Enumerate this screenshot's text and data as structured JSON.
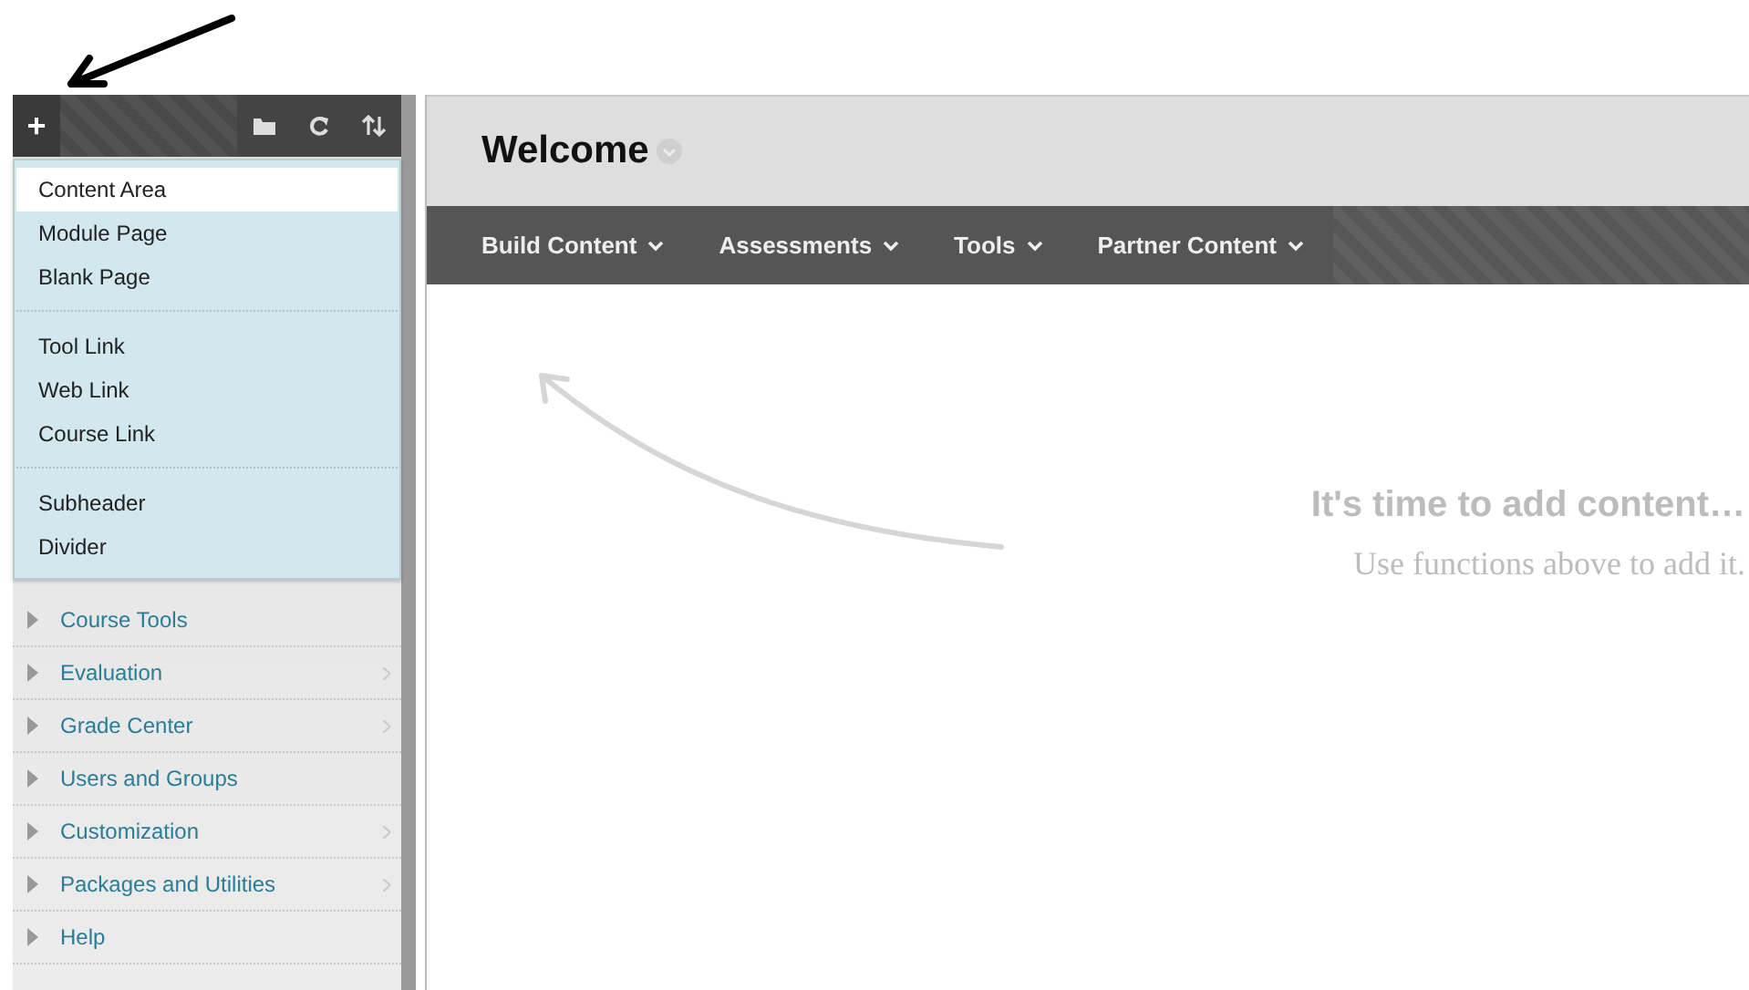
{
  "sidebar": {
    "toolbar": {
      "add_button": "+"
    },
    "add_menu": {
      "groups": [
        [
          {
            "label": "Content Area",
            "selected": true
          },
          {
            "label": "Module Page",
            "selected": false
          },
          {
            "label": "Blank Page",
            "selected": false
          }
        ],
        [
          {
            "label": "Tool Link",
            "selected": false
          },
          {
            "label": "Web Link",
            "selected": false
          },
          {
            "label": "Course Link",
            "selected": false
          }
        ],
        [
          {
            "label": "Subheader",
            "selected": false
          },
          {
            "label": "Divider",
            "selected": false
          }
        ]
      ]
    },
    "items": [
      {
        "label": "Course Tools",
        "has_submenu": false
      },
      {
        "label": "Evaluation",
        "has_submenu": true
      },
      {
        "label": "Grade Center",
        "has_submenu": true
      },
      {
        "label": "Users and Groups",
        "has_submenu": false
      },
      {
        "label": "Customization",
        "has_submenu": true
      },
      {
        "label": "Packages and Utilities",
        "has_submenu": true
      },
      {
        "label": "Help",
        "has_submenu": false
      }
    ]
  },
  "main": {
    "title": "Welcome",
    "action_bar": [
      "Build Content",
      "Assessments",
      "Tools",
      "Partner Content"
    ],
    "empty_state": {
      "heading": "It's time to add content…",
      "message": "Use functions above to add it."
    }
  }
}
